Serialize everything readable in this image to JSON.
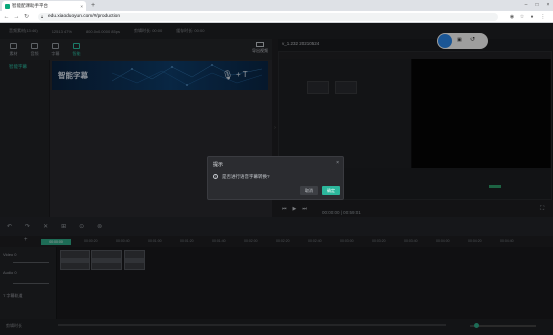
{
  "browser": {
    "tab_title": "智能配课助手平台",
    "new_tab": "+",
    "close_tab": "×",
    "url": "edu.xiaoduoyun.com/#/production",
    "window": {
      "minimize": "–",
      "maximize": "□",
      "close": "×"
    },
    "nav": {
      "back": "←",
      "forward": "→",
      "reload": "↻"
    }
  },
  "infobar": {
    "items": [
      "音频素材(13:46)",
      "12513 47%",
      "800.0x0.0000 85ps",
      "剪辑时长: 00:00",
      "缓存时长: 00:00"
    ]
  },
  "left_panel": {
    "tabs": [
      {
        "label": "素材",
        "active": false
      },
      {
        "label": "音频",
        "active": false
      },
      {
        "label": "字幕",
        "active": false
      },
      {
        "label": "智能",
        "active": true
      }
    ],
    "subnav_item": "智能字幕",
    "banner_title": "智能字幕",
    "banner_suffix": "+ T",
    "export_label": "导出视频"
  },
  "preview": {
    "title": "v_1.232 20210524",
    "timecode": "00:00:00 | 00:59:01",
    "controls": [
      "⏮",
      "▶",
      "⏭"
    ]
  },
  "timeline": {
    "toolbar": [
      "↶",
      "↷",
      "✕",
      "⊞",
      "⊙",
      "⊚"
    ],
    "playhead": "00:00:00",
    "ticks": [
      "00:00:00",
      "00:00:20",
      "00:00:40",
      "00:01:00",
      "00:01:20",
      "00:01:40",
      "00:02:00",
      "00:02:20",
      "00:02:40",
      "00:03:00",
      "00:03:20",
      "00:03:40",
      "00:04:00",
      "00:04:20",
      "00:04:40"
    ],
    "tracks": [
      "Video 0",
      "Audio 0",
      "T 字幕轨道"
    ]
  },
  "status": {
    "left": "剪辑时长"
  },
  "dialog": {
    "title": "提示",
    "close": "×",
    "message": "是否进行语音字幕转换?",
    "cancel_label": "取消",
    "ok_label": "确定"
  },
  "colors": {
    "accent": "#2cb79c",
    "background": "#1c1d20",
    "panel": "#2a2b2f"
  }
}
